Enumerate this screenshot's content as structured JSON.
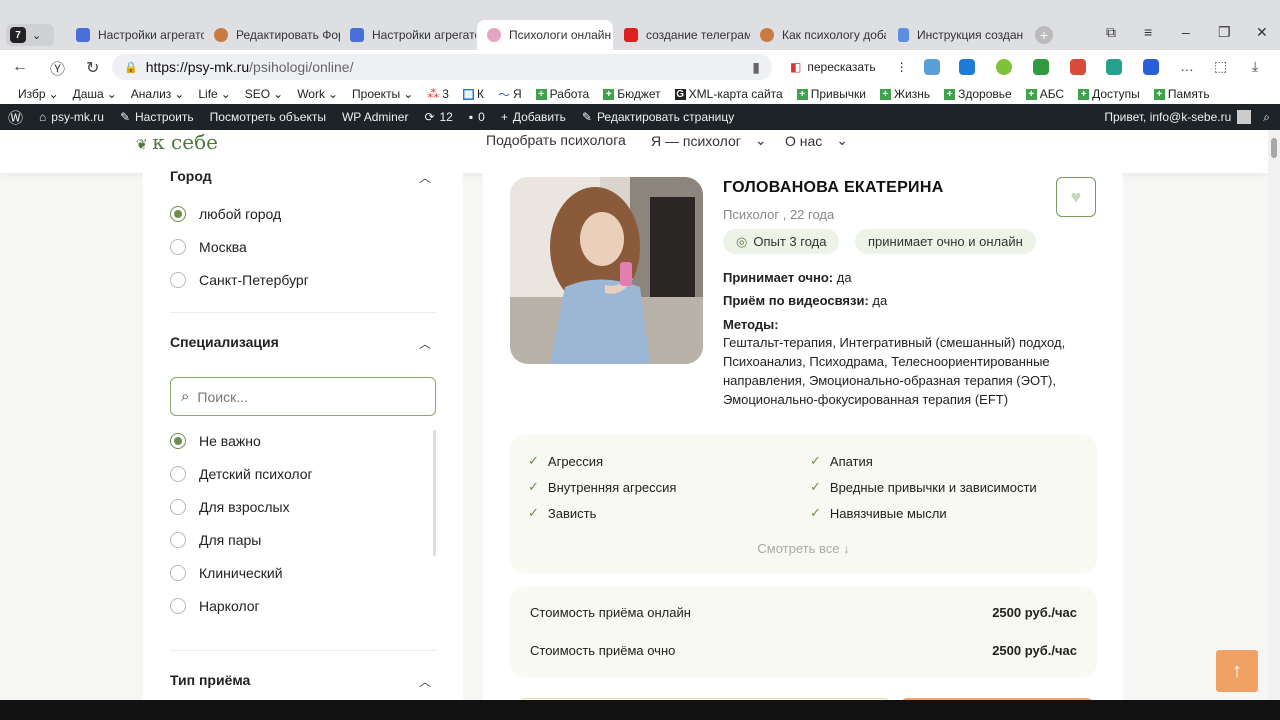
{
  "browser": {
    "tab_count": "7",
    "tabs": [
      {
        "label": "Настройки агрегато"
      },
      {
        "label": "Редактировать Фор"
      },
      {
        "label": "Настройки агрегато"
      },
      {
        "label": "Психологи онлайн"
      },
      {
        "label": "создание телеграм"
      },
      {
        "label": "Как психологу доба"
      },
      {
        "label": "Инструкция создан"
      }
    ],
    "url_domain": "https://psy-mk.ru",
    "url_path": "/psihologi/online/",
    "translate_label": "пересказать",
    "bookmarks": [
      "Избр",
      "Даша",
      "Анализ",
      "Life",
      "SEO",
      "Work",
      "Проекты",
      "3",
      "К",
      "Я",
      "Работа",
      "Бюджет",
      "XML-карта сайта",
      "Привычки",
      "Жизнь",
      "Здоровье",
      "АБС",
      "Доступы",
      "Память"
    ]
  },
  "wp_admin": {
    "site": "psy-mk.ru",
    "customize": "Настроить",
    "view_objects": "Посмотреть объекты",
    "adminer": "WP Adminer",
    "updates": "12",
    "comments": "0",
    "add_new": "Добавить",
    "edit_page": "Редактировать страницу",
    "greeting": "Привет, info@k-sebe.ru"
  },
  "site": {
    "logo": "к себе",
    "nav": [
      "Подобрать психолога",
      "Я — психолог",
      "О нас"
    ]
  },
  "filters": {
    "city_title": "Город",
    "cities": [
      "любой город",
      "Москва",
      "Санкт-Петербург"
    ],
    "spec_title": "Специализация",
    "search_placeholder": "Поиск...",
    "specs": [
      "Не важно",
      "Детский психолог",
      "Для взрослых",
      "Для пары",
      "Клинический",
      "Нарколог"
    ],
    "reception_title": "Тип приёма"
  },
  "psychologist": {
    "name": "ГОЛОВАНОВА ЕКАТЕРИНА",
    "subtitle": "Психолог , 22 года",
    "experience": "Опыт 3 года",
    "format": "принимает очно и онлайн",
    "inperson_label": "Принимает очно:",
    "inperson_value": "да",
    "video_label": "Приём по видеосвязи:",
    "video_value": "да",
    "methods_label": "Методы:",
    "methods": "Гештальт-терапия, Интегративный (смешанный) подход, Психоанализ, Психодрама, Телесноориентированные направления, Эмоционально-образная терапия (ЭОТ), Эмоционально-фокусированная терапия (EFT)",
    "tags": [
      "Агрессия",
      "Апатия",
      "Внутренняя агрессия",
      "Вредные привычки и зависимости",
      "Зависть",
      "Навязчивые мысли"
    ],
    "see_all": "Смотреть все",
    "price_online_label": "Стоимость приёма онлайн",
    "price_online": "2500 руб./час",
    "price_offline_label": "Стоимость приёма очно",
    "price_offline": "2500 руб./час"
  }
}
